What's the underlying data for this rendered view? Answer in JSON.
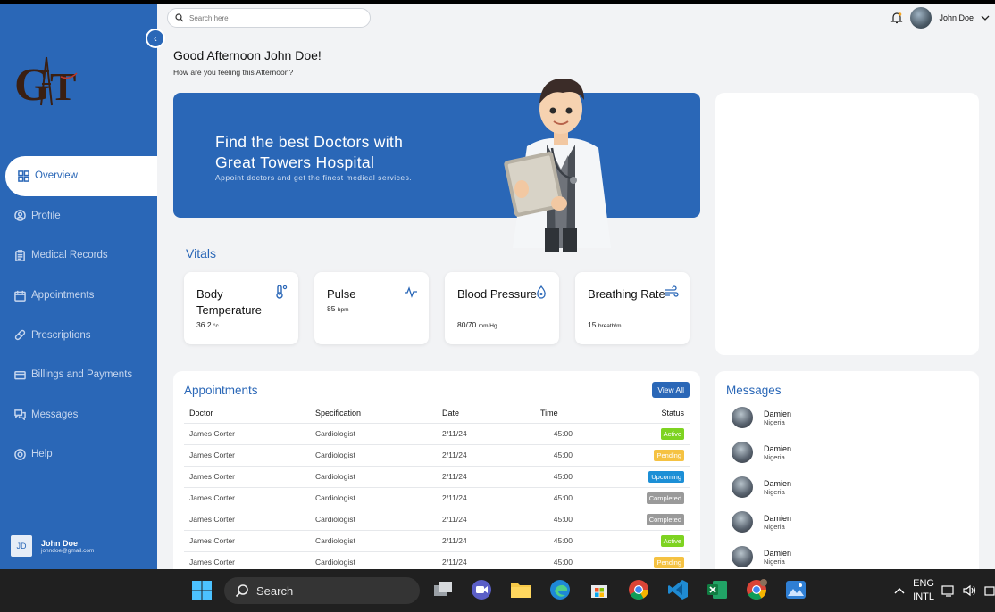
{
  "search": {
    "placeholder": "Search here"
  },
  "user": {
    "name": "John Doe",
    "initials": "JD",
    "email": "johndoe@gmail.com"
  },
  "sidebar": {
    "items": [
      {
        "label": "Overview",
        "icon": "grid-icon",
        "active": true
      },
      {
        "label": "Profile",
        "icon": "user-icon"
      },
      {
        "label": "Medical Records",
        "icon": "clipboard-icon"
      },
      {
        "label": "Appointments",
        "icon": "calendar-icon"
      },
      {
        "label": "Prescriptions",
        "icon": "pill-icon"
      },
      {
        "label": "Billings and Payments",
        "icon": "card-icon"
      },
      {
        "label": "Messages",
        "icon": "chat-icon"
      },
      {
        "label": "Help",
        "icon": "help-icon"
      }
    ]
  },
  "greeting": {
    "title": "Good Afternoon John Doe!",
    "subtitle": "How are you feeling this Afternoon?"
  },
  "banner": {
    "title": "Find the best Doctors with\nGreat Towers Hospital",
    "subtitle": "Appoint doctors and get the finest medical services."
  },
  "vitals": {
    "title": "Vitals",
    "items": [
      {
        "name": "Body Temperature",
        "value": "36.2",
        "unit": "°c",
        "icon": "thermometer-icon"
      },
      {
        "name": "Pulse",
        "value": "85",
        "unit": "bpm",
        "icon": "pulse-icon"
      },
      {
        "name": "Blood Pressure",
        "value": "80/70",
        "unit": "mm/Hg",
        "icon": "blood-drop-icon"
      },
      {
        "name": "Breathing Rate",
        "value": "15",
        "unit": "breath/m",
        "icon": "wind-icon"
      }
    ]
  },
  "appointments": {
    "title": "Appointments",
    "view_all": "View All",
    "columns": [
      "Doctor",
      "Specification",
      "Date",
      "Time",
      "Status"
    ],
    "rows": [
      [
        "James Corter",
        "Cardiologist",
        "2/11/24",
        "45:00",
        "Active"
      ],
      [
        "James Corter",
        "Cardiologist",
        "2/11/24",
        "45:00",
        "Pending"
      ],
      [
        "James Corter",
        "Cardiologist",
        "2/11/24",
        "45:00",
        "Upcoming"
      ],
      [
        "James Corter",
        "Cardiologist",
        "2/11/24",
        "45:00",
        "Completed"
      ],
      [
        "James Corter",
        "Cardiologist",
        "2/11/24",
        "45:00",
        "Completed"
      ],
      [
        "James Corter",
        "Cardiologist",
        "2/11/24",
        "45:00",
        "Active"
      ],
      [
        "James Corter",
        "Cardiologist",
        "2/11/24",
        "45:00",
        "Pending"
      ]
    ],
    "status_colors": {
      "Active": "#7ed321",
      "Pending": "#f5c242",
      "Upcoming": "#1c8fd6",
      "Completed": "#9a9a9a"
    }
  },
  "messages": {
    "title": "Messages",
    "items": [
      {
        "name": "Damien",
        "location": "Nigeria"
      },
      {
        "name": "Damien",
        "location": "Nigeria"
      },
      {
        "name": "Damien",
        "location": "Nigeria"
      },
      {
        "name": "Damien",
        "location": "Nigeria"
      },
      {
        "name": "Damien",
        "location": "Nigeria"
      }
    ]
  },
  "taskbar": {
    "search_label": "Search",
    "language": "ENG",
    "layout": "INTL",
    "apps": [
      "task-view-icon",
      "teams-icon",
      "file-explorer-icon",
      "edge-icon",
      "store-icon",
      "chrome-icon",
      "vscode-icon",
      "excel-icon",
      "chrome-profile-icon",
      "photos-icon"
    ]
  },
  "colors": {
    "brand": "#2a67b7",
    "background": "#f2f3f5"
  }
}
